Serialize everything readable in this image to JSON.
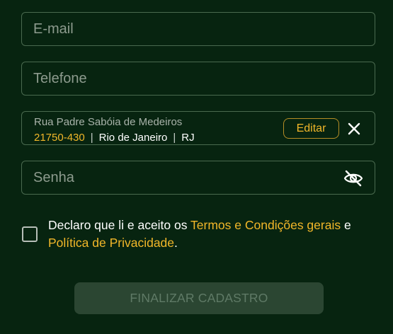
{
  "colors": {
    "background": "#072410",
    "field_border": "#4a6a4f",
    "accent": "#f2b729",
    "button_disabled_bg": "#2b4632",
    "button_disabled_text": "#5f7a66"
  },
  "form": {
    "email": {
      "placeholder": "E-mail",
      "value": ""
    },
    "phone": {
      "placeholder": "Telefone",
      "value": ""
    },
    "address": {
      "street": "Rua Padre Sabóia de Medeiros",
      "cep": "21750-430",
      "separator": "|",
      "city": "Rio de Janeiro",
      "state": "RJ",
      "edit_label": "Editar",
      "clear_icon": "close-icon"
    },
    "password": {
      "placeholder": "Senha",
      "value": "",
      "toggle_icon": "eye-off-icon"
    },
    "terms": {
      "checked": false,
      "prefix": "Declaro que li e aceito os ",
      "terms_link": "Termos e Condições gerais",
      "conjunction": " e ",
      "privacy_link": "Política de Privacidade",
      "suffix": "."
    },
    "submit_label": "FINALIZAR CADASTRO"
  }
}
